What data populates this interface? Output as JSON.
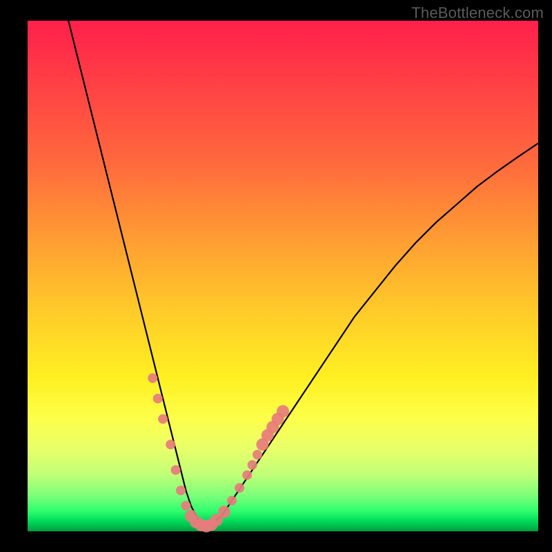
{
  "watermark": {
    "text": "TheBottleneck.com"
  },
  "colors": {
    "background": "#000000",
    "curve_stroke": "#000000",
    "marker_fill": "#e77c7c",
    "marker_stroke": "#e77c7c"
  },
  "chart_data": {
    "type": "line",
    "title": "",
    "xlabel": "",
    "ylabel": "",
    "xlim": [
      0,
      100
    ],
    "ylim": [
      0,
      100
    ],
    "grid": false,
    "legend": false,
    "series": [
      {
        "name": "bottleneck-curve",
        "x": [
          8,
          10,
          12,
          14,
          16,
          18,
          20,
          22,
          24,
          26,
          28,
          30,
          31,
          32,
          33,
          34,
          35,
          36,
          38,
          40,
          44,
          48,
          52,
          56,
          60,
          64,
          68,
          72,
          76,
          80,
          84,
          88,
          92,
          96,
          100
        ],
        "y": [
          100,
          92,
          84,
          76,
          68,
          60,
          52,
          44,
          36,
          28,
          20,
          12,
          8,
          5,
          3,
          1.5,
          1,
          1.5,
          3,
          6,
          12,
          18,
          24,
          30,
          36,
          42,
          47,
          52,
          56.5,
          60.5,
          64,
          67.5,
          70.5,
          73.3,
          76
        ]
      }
    ],
    "markers": {
      "name": "highlighted-points",
      "x": [
        24.5,
        25.5,
        26.5,
        28,
        29,
        30,
        31,
        32,
        33,
        34,
        35,
        36,
        37,
        38.5,
        40,
        41.5,
        43,
        44,
        45,
        46,
        47,
        48,
        49,
        50
      ],
      "y": [
        30,
        26,
        22,
        17,
        12,
        8,
        5,
        3,
        1.8,
        1.2,
        1,
        1.3,
        2.2,
        3.8,
        6,
        8.5,
        11,
        13,
        15,
        17,
        18.8,
        20.4,
        22,
        23.5
      ],
      "size_default": 7,
      "size_large": 9
    }
  }
}
